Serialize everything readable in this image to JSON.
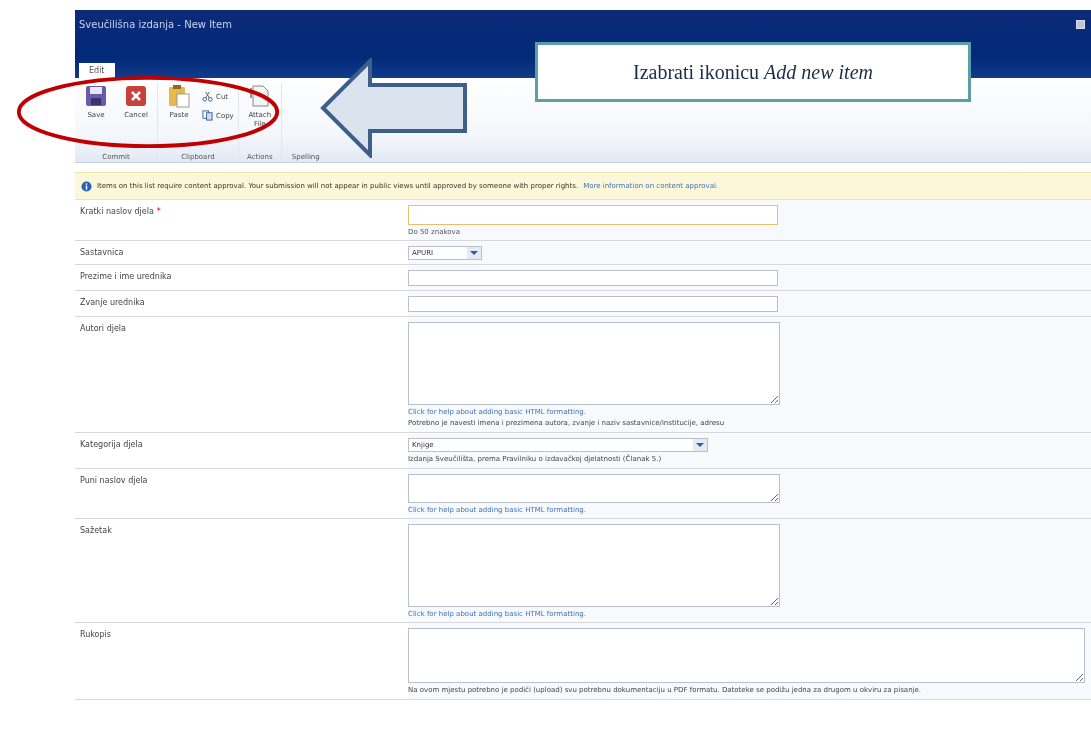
{
  "window": {
    "title": "Sveučilišna izdanja - New Item"
  },
  "ribbon": {
    "tabs": [
      {
        "label": "Edit",
        "selected": true
      }
    ],
    "groups": [
      {
        "label": "Commit",
        "buttons": [
          {
            "label": "Save",
            "kind": "save"
          },
          {
            "label": "Cancel",
            "kind": "cancel"
          }
        ]
      },
      {
        "label": "Clipboard",
        "buttons": [
          {
            "label": "Paste",
            "kind": "paste"
          },
          {
            "label": "Cut",
            "kind": "cut"
          },
          {
            "label": "Copy",
            "kind": "copy"
          }
        ]
      },
      {
        "label": "Actions",
        "buttons": [
          {
            "label": "Attach File",
            "kind": "attach"
          }
        ]
      },
      {
        "label": "Spelling"
      }
    ]
  },
  "notice": {
    "text": "Items on this list require content approval. Your submission will not appear in public views until approved by someone with proper rights.",
    "link": "More information on content approval."
  },
  "form": {
    "fields": [
      {
        "label": "Kratki naslov djela",
        "required_mark": "*",
        "kind": "text",
        "focused": true,
        "hint": "Do 50 znakova"
      },
      {
        "label": "Sastavnica",
        "kind": "select-short",
        "value": "APURI"
      },
      {
        "label": "Prezime i ime urednika",
        "kind": "text",
        "focused": false
      },
      {
        "label": "Zvanje urednika",
        "kind": "text",
        "focused": false
      },
      {
        "label": "Autori djela",
        "kind": "textarea",
        "help_link": "Click for help about adding basic HTML formatting.",
        "note": "Potrebno je navesti imena i prezimena autora, zvanje i naziv sastavnice/institucije, adresu"
      },
      {
        "label": "Kategorija djela",
        "kind": "select-wide",
        "value": "Knjige",
        "note": "Izdanja Sveučilišta, prema Pravilniku o izdavačkoj djelatnosti (Članak 5.)"
      },
      {
        "label": "Puni naslov djela",
        "kind": "textarea-short",
        "help_link": "Click for help about adding basic HTML formatting."
      },
      {
        "label": "Sažetak",
        "kind": "textarea",
        "help_link": "Click for help about adding basic HTML formatting."
      },
      {
        "label": "Rukopis",
        "kind": "wide-box",
        "note": "Na ovom mjestu potrebno je podići (upload) svu potrebnu dokumentaciju u PDF formatu. Datoteke se podižu jedna za drugom u okviru za pisanje."
      }
    ]
  },
  "callout": {
    "text": "Izabrati ikonicu *Add new item*"
  }
}
